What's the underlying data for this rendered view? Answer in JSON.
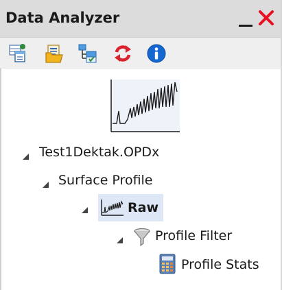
{
  "panel": {
    "title": "Data Analyzer",
    "minimize_icon": "minimize-icon",
    "close_icon": "close-icon",
    "close_color": "#e81123"
  },
  "toolbar": {
    "buttons": [
      {
        "icon": "data-table-icon"
      },
      {
        "icon": "open-folder-icon"
      },
      {
        "icon": "hierarchy-icon"
      },
      {
        "icon": "refresh-icon"
      },
      {
        "icon": "info-icon"
      }
    ]
  },
  "tree": {
    "thumbnail_icon": "profile-chart-thumbnail-icon",
    "nodes": [
      {
        "label": "Test1Dektak.OPDx",
        "expanded": true
      },
      {
        "label": "Surface Profile",
        "expanded": true
      },
      {
        "label": "Raw",
        "expanded": true,
        "selected": true,
        "icon": "profile-wave-icon"
      },
      {
        "label": "Profile Filter",
        "expanded": true,
        "icon": "filter-funnel-icon"
      },
      {
        "label": "Profile Stats",
        "icon": "calculator-icon"
      }
    ]
  }
}
